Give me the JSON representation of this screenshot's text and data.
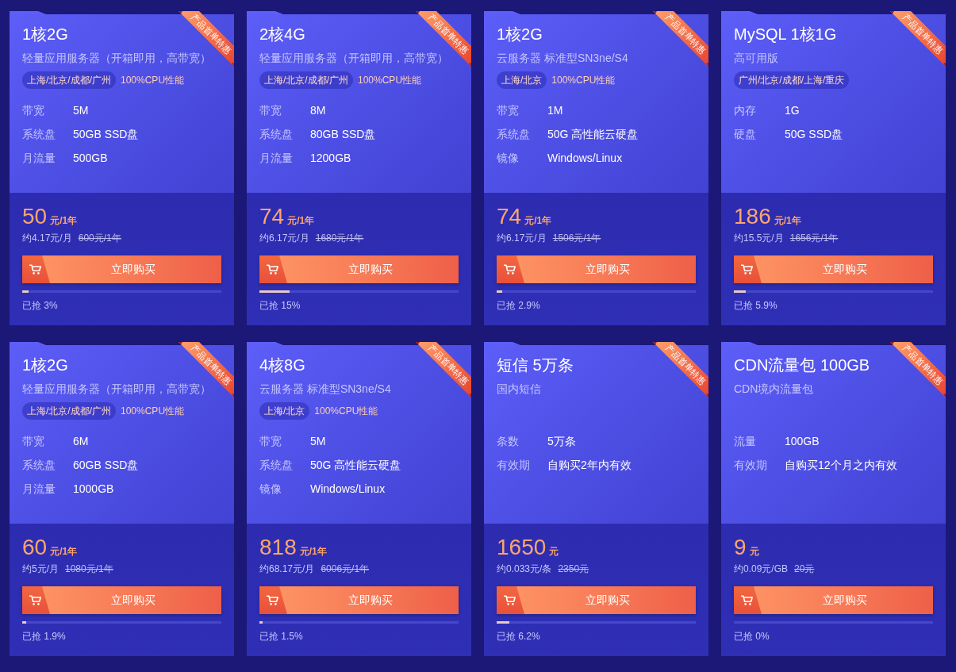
{
  "cards": [
    {
      "title": "1核2G",
      "subtitle": "轻量应用服务器（开箱即用，高带宽）",
      "regions": "上海/北京/成都/广州",
      "feature": "100%CPU性能",
      "ribbon": "产品首单特惠",
      "specs": [
        {
          "label": "带宽",
          "value": "5M"
        },
        {
          "label": "系统盘",
          "value": "50GB SSD盘"
        },
        {
          "label": "月流量",
          "value": "500GB"
        }
      ],
      "price": "50",
      "unit": "元/1年",
      "monthly": "约4.17元/月",
      "original_price": "600元/1年",
      "button": "立即购买",
      "level": 0.03,
      "sold": "已抢 3%"
    },
    {
      "title": "2核4G",
      "subtitle": "轻量应用服务器（开箱即用，高带宽）",
      "regions": "上海/北京/成都/广州",
      "feature": "100%CPU性能",
      "ribbon": "产品首单特惠",
      "specs": [
        {
          "label": "带宽",
          "value": "8M"
        },
        {
          "label": "系统盘",
          "value": "80GB SSD盘"
        },
        {
          "label": "月流量",
          "value": "1200GB"
        }
      ],
      "price": "74",
      "unit": "元/1年",
      "monthly": "约6.17元/月",
      "original_price": "1680元/1年",
      "button": "立即购买",
      "level": 0.15,
      "sold": "已抢 15%"
    },
    {
      "title": "1核2G",
      "subtitle": "云服务器 标准型SN3ne/S4",
      "regions": "上海/北京",
      "feature": "100%CPU性能",
      "ribbon": "产品首单特惠",
      "specs": [
        {
          "label": "带宽",
          "value": "1M"
        },
        {
          "label": "系统盘",
          "value": "50G 高性能云硬盘"
        },
        {
          "label": "镜像",
          "value": "Windows/Linux"
        }
      ],
      "price": "74",
      "unit": "元/1年",
      "monthly": "约6.17元/月",
      "original_price": "1506元/1年",
      "button": "立即购买",
      "level": 0.029,
      "sold": "已抢 2.9%"
    },
    {
      "title": "MySQL 1核1G",
      "subtitle": "高可用版",
      "regions": "广州/北京/成都/上海/重庆",
      "ribbon": "产品首单特惠",
      "specs": [
        {
          "label": "内存",
          "value": "1G"
        },
        {
          "label": "硬盘",
          "value": "50G SSD盘"
        }
      ],
      "price": "186",
      "unit": "元/1年",
      "monthly": "约15.5元/月",
      "original_price": "1656元/1年",
      "button": "立即购买",
      "level": 0.059,
      "sold": "已抢 5.9%"
    },
    {
      "title": "1核2G",
      "subtitle": "轻量应用服务器（开箱即用，高带宽）",
      "regions": "上海/北京/成都/广州",
      "feature": "100%CPU性能",
      "ribbon": "产品首单特惠",
      "specs": [
        {
          "label": "带宽",
          "value": "6M"
        },
        {
          "label": "系统盘",
          "value": "60GB SSD盘"
        },
        {
          "label": "月流量",
          "value": "1000GB"
        }
      ],
      "price": "60",
      "unit": "元/1年",
      "monthly": "约5元/月",
      "original_price": "1080元/1年",
      "button": "立即购买",
      "level": 0.019,
      "sold": "已抢 1.9%"
    },
    {
      "title": "4核8G",
      "subtitle": "云服务器 标准型SN3ne/S4",
      "regions": "上海/北京",
      "feature": "100%CPU性能",
      "ribbon": "产品首单特惠",
      "specs": [
        {
          "label": "带宽",
          "value": "5M"
        },
        {
          "label": "系统盘",
          "value": "50G 高性能云硬盘"
        },
        {
          "label": "镜像",
          "value": "Windows/Linux"
        }
      ],
      "price": "818",
      "unit": "元/1年",
      "monthly": "约68.17元/月",
      "original_price": "6006元/1年",
      "button": "立即购买",
      "level": 0.015,
      "sold": "已抢 1.5%"
    },
    {
      "title": "短信 5万条",
      "subtitle": "国内短信",
      "ribbon": "产品首单特惠",
      "specs": [
        {
          "label": "条数",
          "value": "5万条"
        },
        {
          "label": "有效期",
          "value": "自购买2年内有效"
        }
      ],
      "price": "1650",
      "unit": "元",
      "monthly": "约0.033元/条",
      "original_price": "2350元",
      "button": "立即购买",
      "level": 0.062,
      "sold": "已抢 6.2%"
    },
    {
      "title": "CDN流量包 100GB",
      "subtitle": "CDN境内流量包",
      "ribbon": "产品首单特惠",
      "specs": [
        {
          "label": "流量",
          "value": "100GB"
        },
        {
          "label": "有效期",
          "value": "自购买12个月之内有效"
        }
      ],
      "price": "9",
      "unit": "元",
      "monthly": "约0.09元/GB",
      "original_price": "20元",
      "button": "立即购买",
      "level": 0,
      "sold": "已抢 0%"
    }
  ]
}
